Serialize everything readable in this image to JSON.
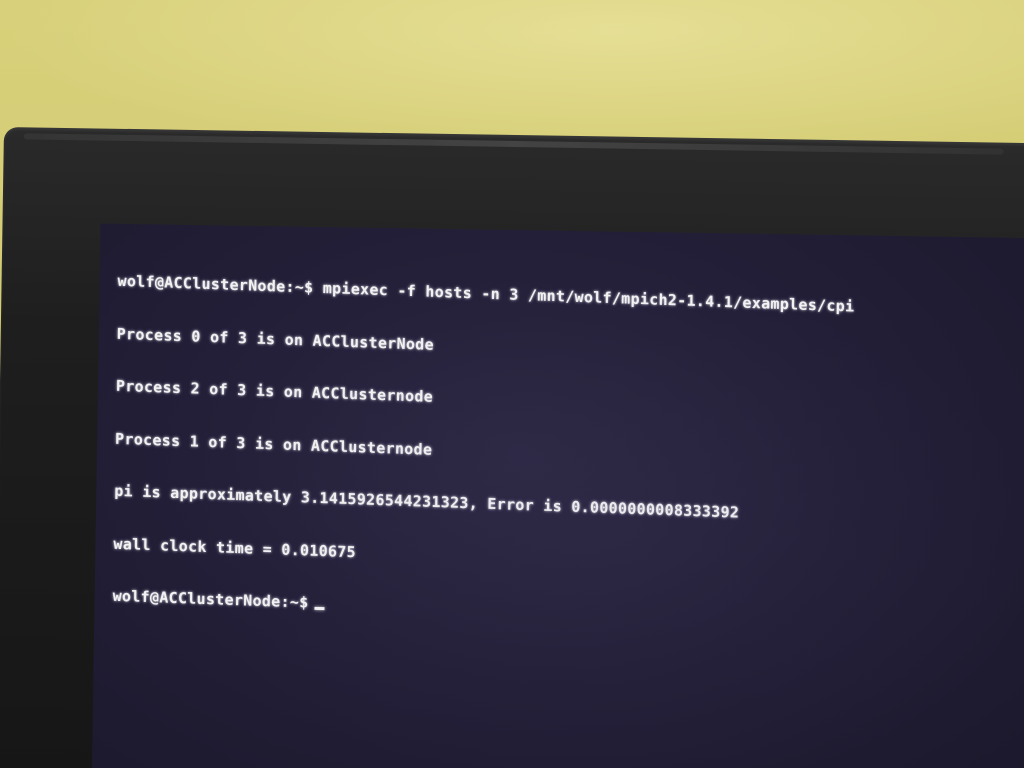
{
  "terminal": {
    "lines": [
      "wolf@ACClusterNode:~$ mpiexec -f hosts -n 3 /mnt/wolf/mpich2-1.4.1/examples/cpi",
      "Process 0 of 3 is on ACClusterNode",
      "Process 2 of 3 is on ACClusternode",
      "Process 1 of 3 is on ACClusternode",
      "pi is approximately 3.1415926544231323, Error is 0.0000000008333392",
      "wall clock time = 0.010675"
    ],
    "prompt": "wolf@ACClusterNode:~$"
  },
  "colors": {
    "wall": "#d4cc74",
    "bezel": "#1e1e1e",
    "screen_background": "#231f38",
    "text": "#f2f2f2"
  }
}
